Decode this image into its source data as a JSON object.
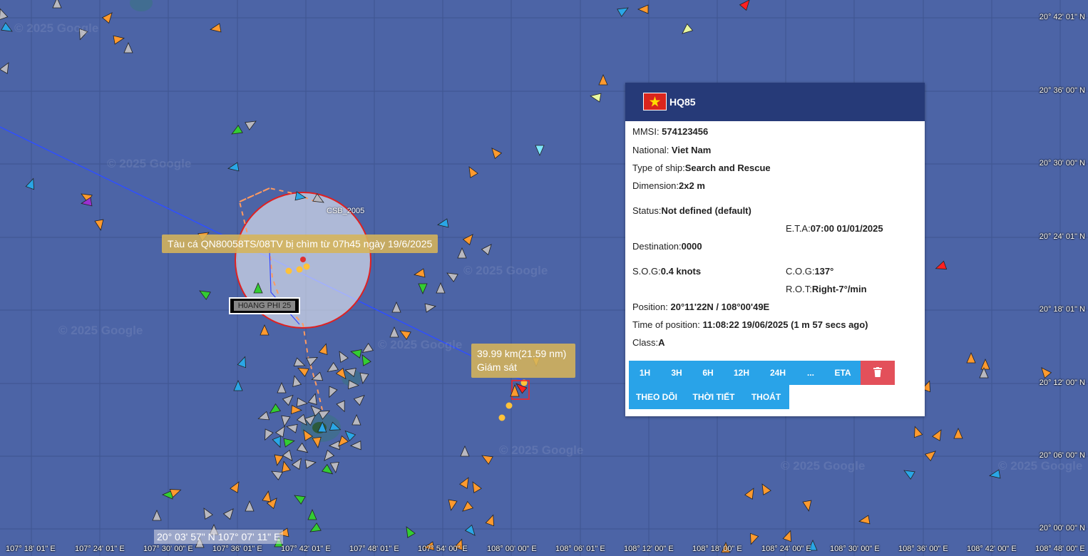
{
  "map": {
    "lat_labels": [
      "20° 42' 01\" N",
      "20° 36' 00\" N",
      "20° 30' 00\" N",
      "20° 24' 01\" N",
      "20° 18' 01\" N",
      "20° 12' 00\" N",
      "20° 06' 00\" N",
      "20° 00' 00\" N"
    ],
    "lon_labels": [
      "107° 18' 01\" E",
      "107° 24' 01\" E",
      "107° 30' 00\" E",
      "107° 36' 01\" E",
      "107° 42' 01\" E",
      "107° 48' 01\" E",
      "107° 54' 00\" E",
      "108° 00' 00\" E",
      "108° 06' 01\" E",
      "108° 12' 00\" E",
      "108° 18' 00\" E",
      "108° 24' 00\" E",
      "108° 30' 00\" E",
      "108° 36' 00\" E",
      "108° 42' 00\" E",
      "108° 48' 00\" E"
    ],
    "watermark": "© 2025 Google",
    "wreck_label": "Tàu cá QN80058TS/08TV bị chìm từ 07h45 ngày 19/6/2025",
    "vessel_label": "H0ANG PHI 25",
    "csb_label": "CSB_2005",
    "distance_line1": "39.99 km(21.59 nm)",
    "distance_line2": "Giám sát",
    "cursor_coords": "20° 03' 57\" N 107° 07' 11\" E",
    "colors": {
      "sea": "#4c64a6",
      "track": "#2f4fff",
      "circle": "#e02020",
      "marker_orange": "#ff9a2e",
      "marker_gray": "#b8b8c0",
      "marker_green": "#33cc33",
      "marker_blue": "#2aa6e6"
    }
  },
  "popup": {
    "ship_name": "HQ85",
    "mmsi_label": "MMSI: ",
    "mmsi": "574123456",
    "national_label": "National: ",
    "national": "Viet Nam",
    "type_label": "Type of ship:",
    "type": "Search and Rescue",
    "dimension_label": "Dimension:",
    "dimension": "2x2 m",
    "status_label": "Status:",
    "status": "Not defined (default)",
    "eta_label": "E.T.A:",
    "eta": "07:00 01/01/2025",
    "destination_label": "Destination:",
    "destination": "0000",
    "sog_label": "S.O.G:",
    "sog": "0.4 knots",
    "cog_label": "C.O.G:",
    "cog": "137°",
    "rot_label": "R.O.T:",
    "rot": "Right-7°/min",
    "position_label": "Position: ",
    "position": "20°11'22N / 108°00'49E",
    "time_label": "Time of position: ",
    "time": "11:08:22 19/06/2025 (1 m 57 secs ago)",
    "class_label": "Class:",
    "class": "A",
    "buttons": [
      "1H",
      "3H",
      "6H",
      "12H",
      "24H",
      "...",
      "ETA"
    ],
    "buttons2": [
      "THEO DÕI",
      "THỜI TIẾT",
      "THOÁT"
    ]
  }
}
